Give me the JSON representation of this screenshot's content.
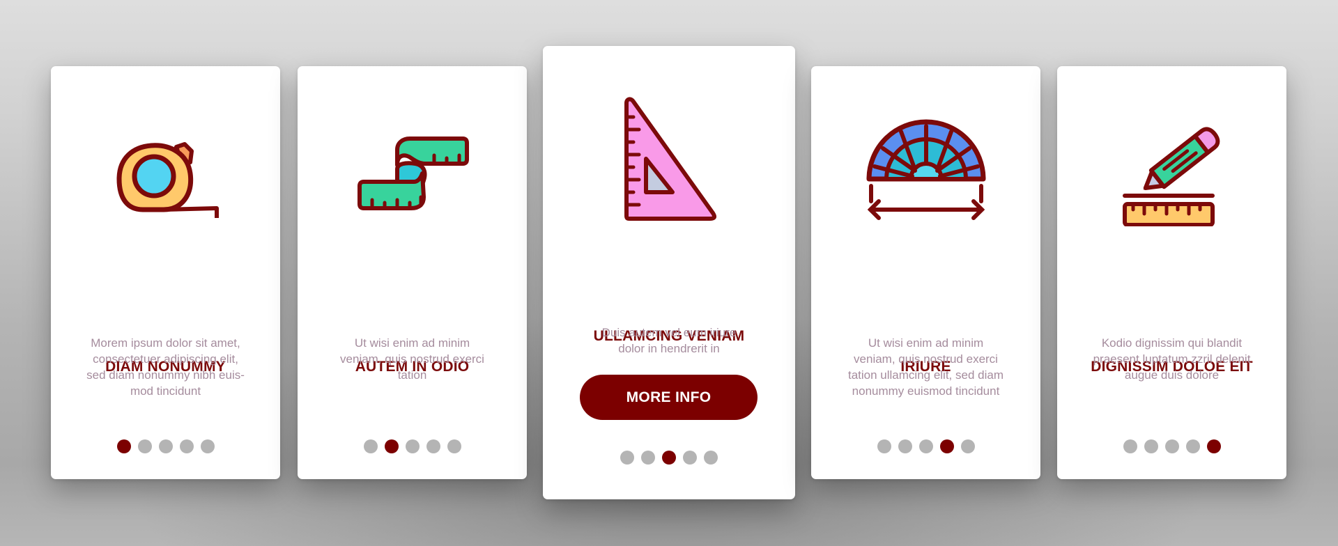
{
  "colors": {
    "accent": "#7c0000",
    "title": "#7b0a0a",
    "body_text": "#a58c9d",
    "dot_inactive": "#b4b4b4",
    "dot_active": "#7c0000",
    "icon_outline": "#7c0a0a"
  },
  "cards": [
    {
      "icon": "tape-measure-icon",
      "title": "DIAM NONUMMY",
      "body_lines": [
        "Morem ipsum dolor sit amet,",
        "consectetuer adipiscing elit,",
        "sed diam nonummy nibh euis-",
        "mod tincidunt"
      ],
      "active_page": 1,
      "page_count": 5
    },
    {
      "icon": "measuring-tape-ribbon-icon",
      "title": "AUTEM IN ODIO",
      "body_lines": [
        "Ut wisi enim ad minim",
        "veniam, quis nostrud exerci",
        "tation"
      ],
      "active_page": 2,
      "page_count": 5
    },
    {
      "icon": "set-square-icon",
      "title": "ULLAMCING VENIAM",
      "body_lines": [
        "Duis autem vel eum iriure",
        "dolor in hendrerit in"
      ],
      "button_label": "MORE INFO",
      "active_page": 3,
      "page_count": 5
    },
    {
      "icon": "protractor-icon",
      "title": "IRIURE",
      "body_lines": [
        "Ut wisi enim ad minim",
        "veniam, quis nostrud exerci",
        "tation ullamcing elit, sed diam",
        "nonummy euismod tincidunt"
      ],
      "active_page": 4,
      "page_count": 5
    },
    {
      "icon": "pencil-ruler-icon",
      "title": "DIGNISSIM DOLOE EIT",
      "body_lines": [
        "Kodio dignissim qui blandit",
        "praesent luptatum zzril delenit",
        "augue duis dolore"
      ],
      "active_page": 5,
      "page_count": 5
    }
  ]
}
